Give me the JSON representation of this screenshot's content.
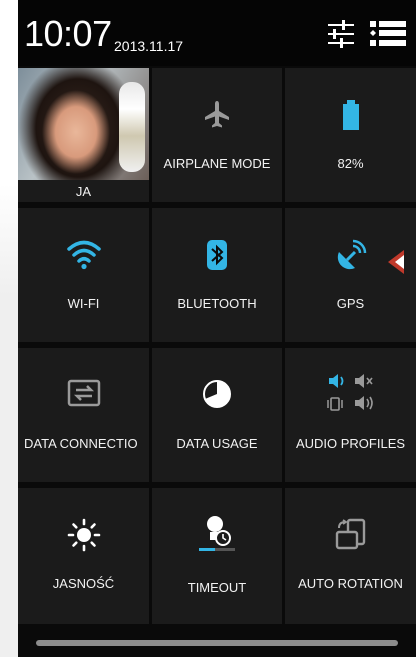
{
  "status": {
    "time": "10:07",
    "date": "2013.11.17",
    "settings_icon": "sliders-icon",
    "list_icon": "list-icon"
  },
  "tiles": [
    {
      "label": "JA",
      "icon": "profile-photo"
    },
    {
      "label": "AIRPLANE MODE",
      "icon": "airplane-icon"
    },
    {
      "label": "82%",
      "icon": "battery-icon"
    },
    {
      "label": "WI-FI",
      "icon": "wifi-icon"
    },
    {
      "label": "BLUETOOTH",
      "icon": "bluetooth-icon"
    },
    {
      "label": "GPS",
      "icon": "gps-icon"
    },
    {
      "label": "DATA CONNECTIO",
      "icon": "data-connection-icon"
    },
    {
      "label": "DATA USAGE",
      "icon": "data-usage-icon"
    },
    {
      "label": "AUDIO PROFILES",
      "icon": "audio-profiles-icon"
    },
    {
      "label": "JASNOŚĆ",
      "icon": "brightness-icon"
    },
    {
      "label": "TIMEOUT",
      "icon": "timeout-icon"
    },
    {
      "label": "AUTO ROTATION",
      "icon": "auto-rotation-icon"
    }
  ],
  "colors": {
    "accent": "#33b5e5",
    "tile_bg": "#1b1b1b",
    "panel_bg": "#0a0a0a",
    "inactive_icon": "#9a9a9a"
  }
}
